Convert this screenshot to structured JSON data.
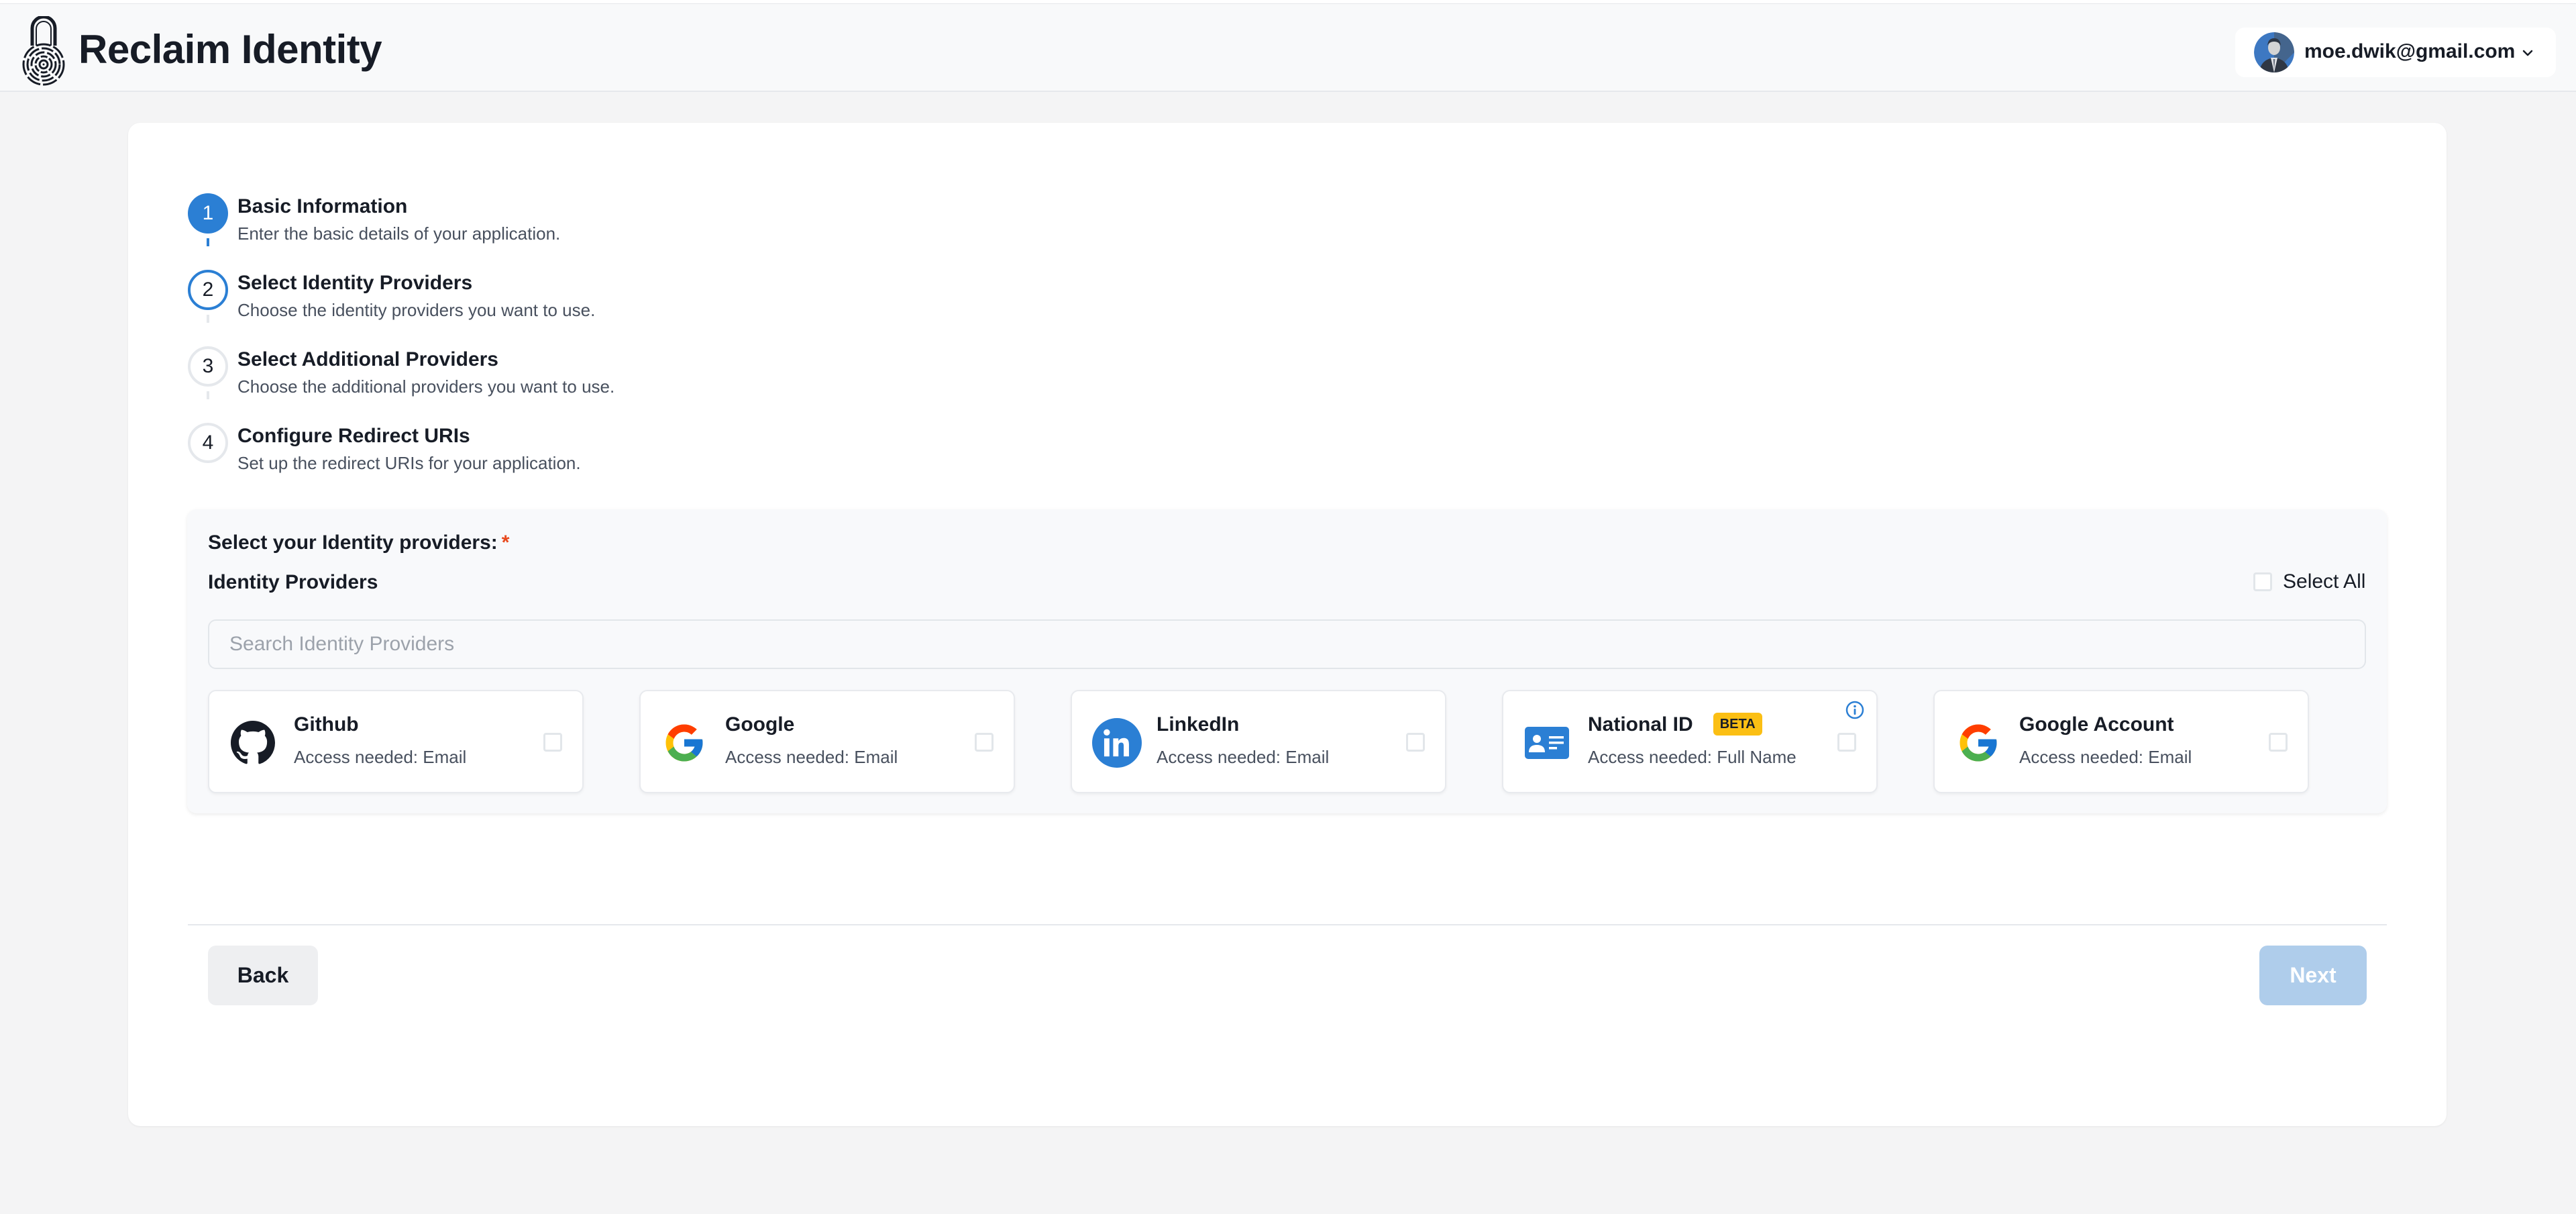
{
  "header": {
    "app_title": "Reclaim Identity",
    "logo_icon": "fingerprint-lock-icon",
    "user": {
      "email": "moe.dwik@gmail.com",
      "avatar_icon": "user-avatar",
      "menu_icon": "chevron-down-icon"
    }
  },
  "stepper": {
    "steps": [
      {
        "number": "1",
        "title": "Basic Information",
        "description": "Enter the basic details of your application.",
        "state": "completed"
      },
      {
        "number": "2",
        "title": "Select Identity Providers",
        "description": "Choose the identity providers you want to use.",
        "state": "active"
      },
      {
        "number": "3",
        "title": "Select Additional Providers",
        "description": "Choose the additional providers you want to use.",
        "state": "pending"
      },
      {
        "number": "4",
        "title": "Configure Redirect URIs",
        "description": "Set up the redirect URIs for your application.",
        "state": "pending"
      }
    ]
  },
  "providers_panel": {
    "label": "Select your Identity providers:",
    "required_marker": "*",
    "subtitle": "Identity Providers",
    "select_all_label": "Select All",
    "select_all_checked": false,
    "search": {
      "placeholder": "Search Identity Providers",
      "value": ""
    },
    "providers": [
      {
        "name": "Github",
        "access": "Access needed: Email",
        "icon": "github-icon",
        "checked": false,
        "badge": null,
        "info": false
      },
      {
        "name": "Google",
        "access": "Access needed: Email",
        "icon": "google-icon",
        "checked": false,
        "badge": null,
        "info": false
      },
      {
        "name": "LinkedIn",
        "access": "Access needed: Email",
        "icon": "linkedin-icon",
        "checked": false,
        "badge": null,
        "info": false
      },
      {
        "name": "National ID",
        "access": "Access needed: Full Name",
        "icon": "id-card-icon",
        "checked": false,
        "badge": "BETA",
        "info": true
      },
      {
        "name": "Google Account",
        "access": "Access needed: Email",
        "icon": "google-icon",
        "checked": false,
        "badge": null,
        "info": false
      }
    ]
  },
  "footer": {
    "back_label": "Back",
    "next_label": "Next",
    "next_disabled": true
  },
  "colors": {
    "accent": "#2B7FD4",
    "next_disabled_bg": "#AFCDEB",
    "beta_badge": "#FBBF14",
    "required": "#E8491D",
    "page_bg": "#F4F4F5"
  }
}
